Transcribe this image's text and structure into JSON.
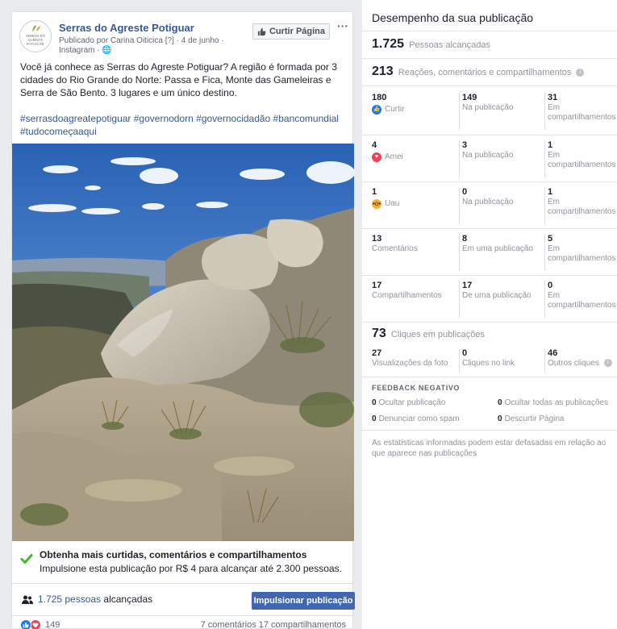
{
  "post": {
    "page_name": "Serras do Agreste Potiguar",
    "avatar_text": [
      "SERRAS DO",
      "AGRESTE",
      "POTIGUAR"
    ],
    "meta": "Publicado por Carina Oiticica [?] · 4 de junho · Instagram · 🌐",
    "like_page_label": "Curtir Página",
    "more_label": "···",
    "text": "Você já conhece as Serras do Agreste Potiguar? A região é formada por 3 cidades do Rio Grande do Norte: Passa e Fica, Monte das Gameleiras e Serra de São Bento. 3 lugares e um único destino.",
    "hashtags": "#serrasdoagreatepotiguar #governodorn #governocidadão #bancomundial #tudocomeçaaqui",
    "boost_title": "Obtenha mais curtidas, comentários e compartilhamentos",
    "boost_desc": "Impulsione esta publicação por R$ 4 para alcançar até 2.300 pessoas.",
    "reach_count": "1.725 pessoas",
    "reach_suffix": "alcançadas",
    "boost_button": "Impulsionar publicação",
    "reaction_count": "149",
    "comment_share_stats": "7 comentários  17 compartilhamentos"
  },
  "insights": {
    "title": "Desempenho da sua publicação",
    "reached_num": "1.725",
    "reached_label": "Pessoas alcançadas",
    "engage_num": "213",
    "engage_label": "Reações, comentários e compartilhamentos",
    "rows": [
      {
        "c1v": "180",
        "c1l": "Curtir",
        "c2v": "149",
        "c2l": "Na publicação",
        "c3v": "31",
        "c3l": "Em compartilhamentos"
      },
      {
        "c1v": "4",
        "c1l": "Amei",
        "c2v": "3",
        "c2l": "Na publicação",
        "c3v": "1",
        "c3l": "Em compartilhamentos"
      },
      {
        "c1v": "1",
        "c1l": "Uau",
        "c2v": "0",
        "c2l": "Na publicação",
        "c3v": "1",
        "c3l": "Em compartilhamentos"
      },
      {
        "c1v": "13",
        "c1l": "Comentários",
        "c2v": "8",
        "c2l": "Em uma publicação",
        "c3v": "5",
        "c3l": "Em compartilhamentos"
      },
      {
        "c1v": "17",
        "c1l": "Compartilhamentos",
        "c2v": "17",
        "c2l": "De uma publicação",
        "c3v": "0",
        "c3l": "Em compartilhamentos"
      }
    ],
    "clicks_num": "73",
    "clicks_label": "Cliques em publicações",
    "clicks": [
      {
        "v": "27",
        "l": "Visualizações da foto"
      },
      {
        "v": "0",
        "l": "Cliques no link"
      },
      {
        "v": "46",
        "l": "Outros cliques"
      }
    ],
    "feedback_heading": "FEEDBACK NEGATIVO",
    "negative": [
      {
        "v": "0",
        "l": "Ocultar publicação"
      },
      {
        "v": "0",
        "l": "Ocultar todas as publicações"
      },
      {
        "v": "0",
        "l": "Denunciar como spam"
      },
      {
        "v": "0",
        "l": "Descurtir Página"
      }
    ],
    "disclaimer": "As estatísticas informadas podem estar defasadas em relação ao que aparece nas publicações"
  },
  "colors": {
    "link": "#385898",
    "button": "#4267b2",
    "like": "#1877f2",
    "love": "#f33e58",
    "wow": "#f7b125",
    "check": "#42b72a"
  },
  "icons": [
    "thumbs-up-icon",
    "more-icon",
    "globe-icon",
    "check-icon",
    "people-icon",
    "like-reaction-icon",
    "love-reaction-icon",
    "wow-reaction-icon",
    "info-icon"
  ]
}
